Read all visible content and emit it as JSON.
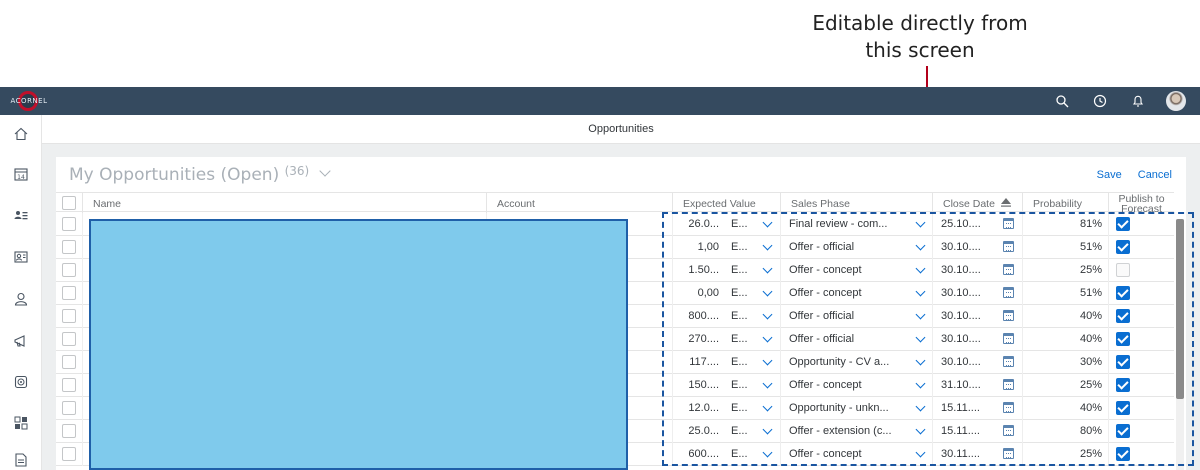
{
  "annotation": {
    "line1": "Editable directly from",
    "line2": "this screen"
  },
  "shell": {
    "logo_text": "ACORNEL",
    "icons": [
      "search-icon",
      "history-icon",
      "bell-icon",
      "avatar"
    ]
  },
  "sidenav": {
    "icons": [
      "home-icon",
      "calendar-icon",
      "accounts-icon",
      "contacts-icon",
      "person-icon",
      "megaphone-icon",
      "target-icon",
      "apps-icon",
      "document-icon"
    ],
    "calendar_day": "14"
  },
  "page": {
    "title": "Opportunities"
  },
  "card": {
    "title": "My Opportunities (Open)",
    "count": "(36)",
    "save": "Save",
    "cancel": "Cancel"
  },
  "columns": {
    "name": "Name",
    "account": "Account",
    "expected_value": "Expected Value",
    "sales_phase": "Sales Phase",
    "close_date": "Close Date",
    "probability": "Probability",
    "publish_line1": "Publish to",
    "publish_line2": "Forecast"
  },
  "rows": [
    {
      "value": "26.0...",
      "currency": "E...",
      "phase": "Final review - com...",
      "date": "25.10....",
      "prob": "81%",
      "publish": true
    },
    {
      "value": "1,00",
      "currency": "E...",
      "phase": "Offer - official",
      "date": "30.10....",
      "prob": "51%",
      "publish": true
    },
    {
      "value": "1.50...",
      "currency": "E...",
      "phase": "Offer - concept",
      "date": "30.10....",
      "prob": "25%",
      "publish": false
    },
    {
      "value": "0,00",
      "currency": "E...",
      "phase": "Offer - concept",
      "date": "30.10....",
      "prob": "51%",
      "publish": true
    },
    {
      "value": "800....",
      "currency": "E...",
      "phase": "Offer - official",
      "date": "30.10....",
      "prob": "40%",
      "publish": true
    },
    {
      "value": "270....",
      "currency": "E...",
      "phase": "Offer - official",
      "date": "30.10....",
      "prob": "40%",
      "publish": true
    },
    {
      "value": "117....",
      "currency": "E...",
      "phase": "Opportunity - CV a...",
      "date": "30.10....",
      "prob": "30%",
      "publish": true
    },
    {
      "value": "150....",
      "currency": "E...",
      "phase": "Offer - concept",
      "date": "31.10....",
      "prob": "25%",
      "publish": true
    },
    {
      "value": "12.0...",
      "currency": "E...",
      "phase": "Opportunity - unkn...",
      "date": "15.11....",
      "prob": "40%",
      "publish": true
    },
    {
      "value": "25.0...",
      "currency": "E...",
      "phase": "Offer - extension (c...",
      "date": "15.11....",
      "prob": "80%",
      "publish": true
    },
    {
      "value": "600....",
      "currency": "E...",
      "phase": "Offer - concept",
      "date": "30.11....",
      "prob": "25%",
      "publish": true
    }
  ],
  "colors": {
    "shell": "#354a5f",
    "accent": "#0a6ed1",
    "annotation_arrow": "#b3001b",
    "redaction": "#7fcaec"
  }
}
